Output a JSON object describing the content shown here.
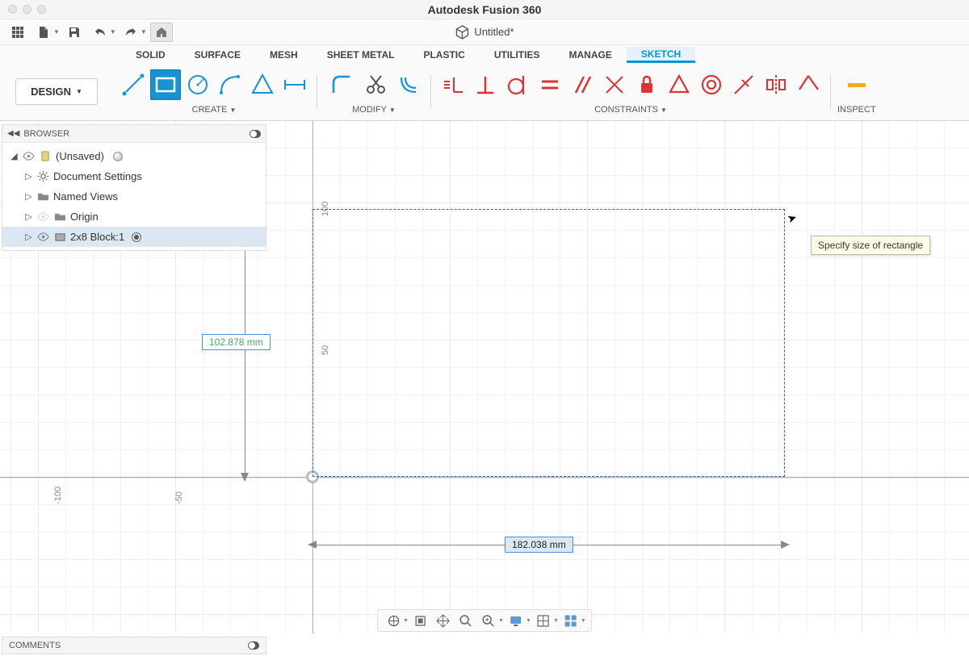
{
  "app": {
    "title": "Autodesk Fusion 360"
  },
  "document": {
    "name": "Untitled*"
  },
  "workspace": {
    "label": "DESIGN"
  },
  "tabs": [
    {
      "label": "SOLID",
      "active": false
    },
    {
      "label": "SURFACE",
      "active": false
    },
    {
      "label": "MESH",
      "active": false
    },
    {
      "label": "SHEET METAL",
      "active": false
    },
    {
      "label": "PLASTIC",
      "active": false
    },
    {
      "label": "UTILITIES",
      "active": false
    },
    {
      "label": "MANAGE",
      "active": false
    },
    {
      "label": "SKETCH",
      "active": true
    }
  ],
  "ribbon_groups": {
    "create": "CREATE",
    "modify": "MODIFY",
    "constraints": "CONSTRAINTS",
    "inspect": "INSPECT"
  },
  "browser": {
    "title": "BROWSER",
    "root": {
      "label": "(Unsaved)"
    },
    "nodes": [
      {
        "label": "Document Settings"
      },
      {
        "label": "Named Views"
      },
      {
        "label": "Origin"
      },
      {
        "label": "2x8 Block:1",
        "selected": true
      }
    ]
  },
  "comments": {
    "title": "COMMENTS"
  },
  "sketch": {
    "height_dim": "102.878 mm",
    "width_dim": "182.038 mm",
    "tooltip": "Specify size of rectangle",
    "axis_y_labels": [
      "50",
      "100"
    ],
    "axis_x_labels": [
      "-100",
      "-50"
    ]
  },
  "colors": {
    "accent": "#0696D7",
    "tool_active": "#1793D1",
    "sketch_blue": "#2a6cb0",
    "constraint_red": "#d33",
    "lock_red": "#d33"
  }
}
